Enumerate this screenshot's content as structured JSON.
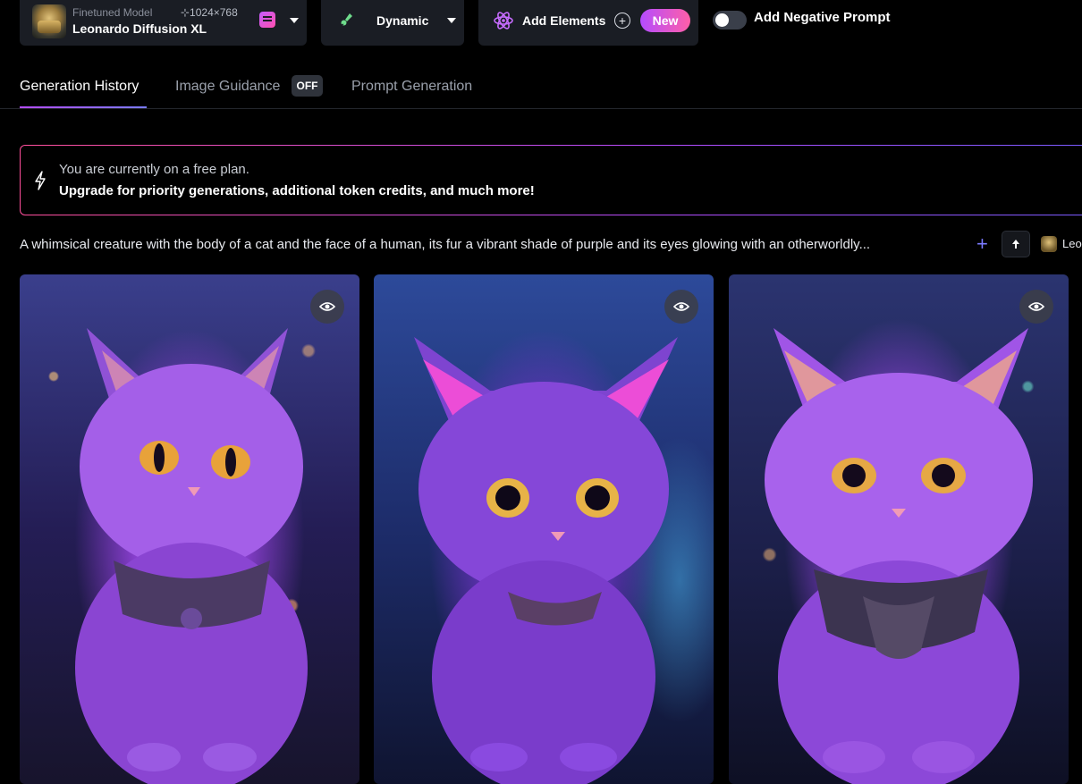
{
  "toolbar": {
    "model": {
      "subtitle": "Finetuned Model",
      "dimensions": "⊹1024×768",
      "name": "Leonardo Diffusion XL",
      "thumbnail_icon": "model-thumbnail"
    },
    "style": {
      "label": "Dynamic",
      "icon": "brush-icon"
    },
    "elements": {
      "label": "Add Elements",
      "icon": "atom-icon",
      "badge": "New"
    },
    "negative_prompt": {
      "label": "Add Negative Prompt",
      "enabled": false
    }
  },
  "tabs": [
    {
      "label": "Generation History",
      "active": true
    },
    {
      "label": "Image Guidance",
      "badge": "OFF",
      "active": false
    },
    {
      "label": "Prompt Generation",
      "active": false
    }
  ],
  "banner": {
    "line1": "You are currently on a free plan.",
    "line2": "Upgrade for priority generations, additional token credits, and much more!"
  },
  "generation": {
    "prompt": "A whimsical creature with the body of a cat and the face of a human, its fur a vibrant shade of purple and its eyes glowing with an otherworldly...",
    "model_short": "Leo",
    "images": [
      {
        "description": "purple kitten with collar",
        "icon": "eye-icon"
      },
      {
        "description": "purple kitten with pink ears",
        "icon": "eye-icon"
      },
      {
        "description": "purple kitten with mechanical collar",
        "icon": "eye-icon"
      }
    ]
  },
  "colors": {
    "accent_purple": "#b44cff",
    "accent_pink": "#ff5fa8",
    "card_bg": "#1a1d24"
  }
}
